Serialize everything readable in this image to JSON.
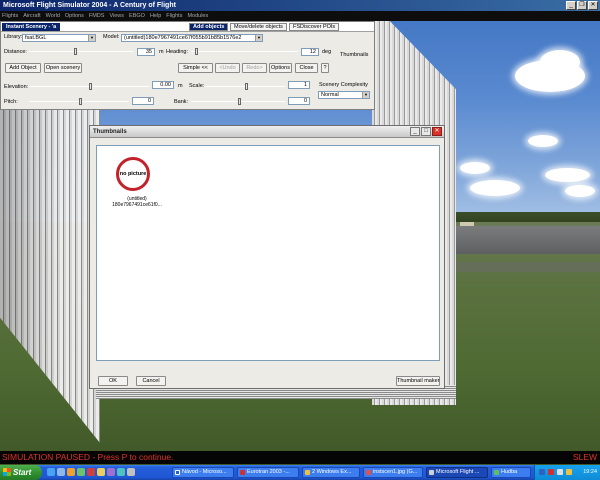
{
  "window": {
    "title": "Microsoft Flight Simulator 2004 - A Century of Flight"
  },
  "menu": [
    "Flights",
    "Aircraft",
    "World",
    "Options",
    "FMDS",
    "Views",
    "EBGO",
    "Help",
    "Flights",
    "Modules"
  ],
  "panel": {
    "title": "Instant Scenery - 'a",
    "tabs": [
      "Add objects",
      "Move/delete objects",
      "FSDiscover POIs"
    ],
    "library_label": "Library:",
    "library_value": "fsat.BGL",
    "model_label": "Model:",
    "model_value": "(untitled)180e7967491ce67f055b91b85b1576e2",
    "distance_label": "Distance:",
    "distance_value": "35",
    "distance_unit": "m",
    "heading_label": "Heading:",
    "heading_value": "12",
    "heading_unit": "deg",
    "thumbnails_label": "Thumbnails",
    "add_object": "Add Object",
    "open_scenery": "Open scenery",
    "simple": "Simple <<",
    "undo": "<Undo",
    "redo": "Redo>",
    "options": "Options",
    "close": "Close",
    "help": "?",
    "elevation_label": "Elevation:",
    "elevation_value": "0.00",
    "elevation_unit": "m",
    "scale_label": "Scale:",
    "scale_value": "1",
    "complexity_label": "Scenery Complexity",
    "complexity_value": "Normal",
    "pitch_label": "Pitch:",
    "pitch_value": "0",
    "bank_label": "Bank:",
    "bank_value": "0"
  },
  "thumbnails": {
    "title": "Thumbnails",
    "item_placeholder": "no picture",
    "item_name": "(untitled)",
    "item_id": "180e7967491ce61f0...",
    "ok": "OK",
    "cancel": "Cancel",
    "maker": "Thumbnail maker"
  },
  "status": {
    "message": "SIMULATION PAUSED - Press P to continue.",
    "mode": "SLEW"
  },
  "taskbar": {
    "start": "Start",
    "tasks": [
      "Návod - Microso...",
      "Eurotran 2003 -...",
      "2 Windows Ex...",
      "instscen1.jpg (G...",
      "Microsoft Flight ...",
      "Hudba"
    ],
    "clock": "19:24"
  }
}
